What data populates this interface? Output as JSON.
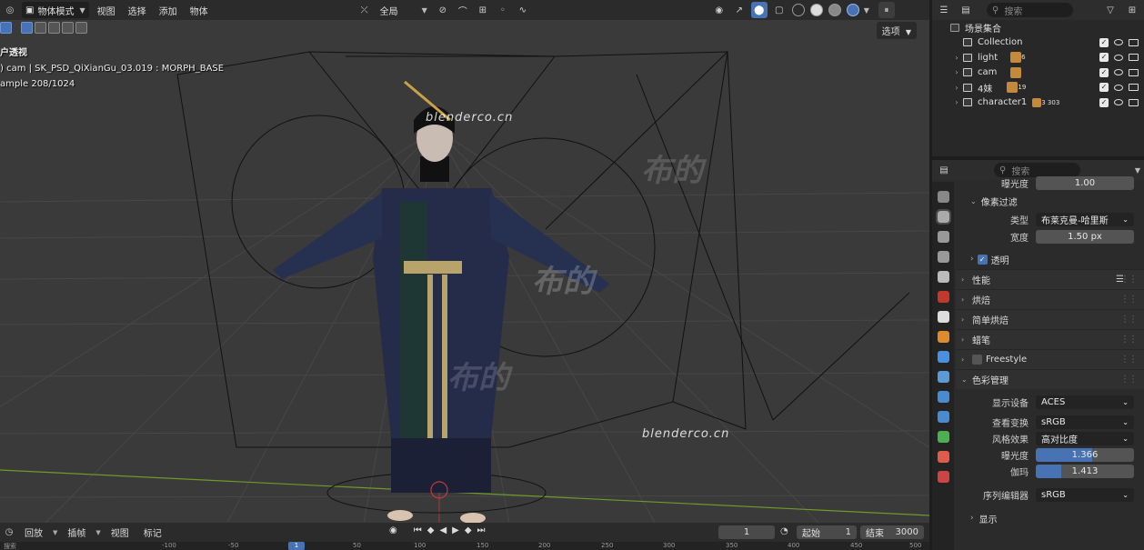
{
  "viewport": {
    "mode": "物体模式",
    "menus": [
      "视图",
      "选择",
      "添加",
      "物体"
    ],
    "transform_orientation": "全局",
    "options_label": "选项",
    "info": {
      "line1": "户透视",
      "line2": ") cam | SK_PSD_QiXianGu_03.019 : MORPH_BASE",
      "line3": "ample 208/1024"
    },
    "watermarks": [
      "blenderco.cn",
      "blenderco.cn"
    ],
    "watermark_big": [
      "布的",
      "布的",
      "布的"
    ]
  },
  "outliner": {
    "search_placeholder": "搜索",
    "scene_collection": "场景集合",
    "rows": [
      {
        "name": "Collection",
        "expandable": false
      },
      {
        "name": "light",
        "expandable": true,
        "count": "6"
      },
      {
        "name": "cam",
        "expandable": true
      },
      {
        "name": "4妹",
        "expandable": true,
        "count": "19"
      },
      {
        "name": "character1",
        "expandable": true,
        "count": "3 303"
      }
    ]
  },
  "properties": {
    "search_placeholder": "搜索",
    "exposure_top": {
      "label": "曝光度",
      "value": "1.00"
    },
    "pixel_filter": {
      "title": "像素过滤",
      "type_label": "类型",
      "type_value": "布莱克曼-哈里斯",
      "width_label": "宽度",
      "width_value": "1.50 px"
    },
    "transparent": "透明",
    "sections": [
      "性能",
      "烘焙",
      "简单烘焙",
      "蜡笔",
      "Freestyle"
    ],
    "color_management": {
      "title": "色彩管理",
      "display_device_label": "显示设备",
      "display_device": "ACES",
      "view_transform_label": "查看变换",
      "view_transform": "sRGB",
      "look_label": "风格效果",
      "look": "高对比度",
      "exposure_label": "曝光度",
      "exposure": "1.366",
      "exposure_fill": 0.57,
      "gamma_label": "伽玛",
      "gamma": "1.413",
      "gamma_fill": 0.26,
      "sequencer_label": "序列编辑器",
      "sequencer": "sRGB",
      "display_section": "显示"
    }
  },
  "timeline": {
    "menus": [
      "回放",
      "插帧",
      "视图",
      "标记"
    ],
    "current_frame": "1",
    "start_label": "起始",
    "start": "1",
    "end_label": "结束",
    "end": "3000",
    "ruler_ticks": [
      "-100",
      "-50",
      "1",
      "50",
      "100",
      "150",
      "200",
      "250",
      "300",
      "350",
      "400",
      "450",
      "500"
    ],
    "ruler_search": "搜索"
  },
  "colors": {
    "accent": "#4772b3",
    "viewport_bg": "#3a3a3a",
    "panel_bg": "#2b2b2b"
  }
}
